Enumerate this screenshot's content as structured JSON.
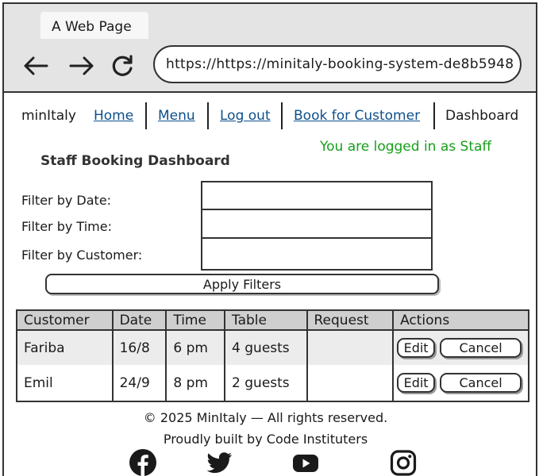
{
  "browser": {
    "tab_title": "A Web Page",
    "url": "https://https://minitaly-booking-system-de8b5948"
  },
  "nav": {
    "brand": "minItaly",
    "links": [
      "Home",
      "Menu",
      "Log out",
      "Book for Customer"
    ],
    "current": "Dashboard"
  },
  "login_message": "You are logged in as Staff",
  "page_title": "Staff Booking Dashboard",
  "filters": {
    "date_label": "Filter by Date:",
    "time_label": "Filter by Time:",
    "customer_label": "Filter by Customer:",
    "date_value": "",
    "time_value": "",
    "customer_value": "",
    "apply_label": "Apply Filters"
  },
  "table": {
    "headers": [
      "Customer",
      "Date",
      "Time",
      "Table",
      "Request",
      "Actions"
    ],
    "rows": [
      {
        "customer": "Fariba",
        "date": "16/8",
        "time": "6 pm",
        "table": "4 guests",
        "request": ""
      },
      {
        "customer": "Emil",
        "date": "24/9",
        "time": "8 pm",
        "table": "2 guests",
        "request": ""
      }
    ],
    "edit_label": "Edit",
    "cancel_label": "Cancel"
  },
  "footer": {
    "copyright": "© 2025 MinItaly — All rights reserved.",
    "credit": "Proudly built by Code Instituters"
  },
  "social_icons": [
    "facebook-icon",
    "twitter-icon",
    "youtube-icon",
    "instagram-icon"
  ],
  "colors": {
    "link": "#0d4f8b",
    "login_message": "#16a01a",
    "table_header_bg": "#cfcfcf",
    "chrome_bg": "#e4e4e4"
  }
}
